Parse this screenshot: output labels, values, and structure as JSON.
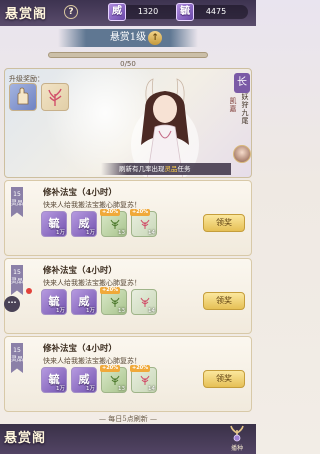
{
  "header": {
    "title": "悬赏阁",
    "help_label": "?",
    "resources": [
      {
        "icon": "currency-icon",
        "glyph": "威",
        "value": "1320"
      },
      {
        "icon": "currency-icon",
        "glyph": "毓",
        "value": "4475"
      }
    ]
  },
  "level": {
    "label": "悬赏1级",
    "upgrade_glyph": "↑",
    "progress_text": "0/50",
    "progress_fraction": 0
  },
  "hero": {
    "reward_label": "升级奖励：",
    "badge": "长",
    "name": "妖狩九尾",
    "title": "凯嘉",
    "refresh_prefix": "刷新有几率出现",
    "refresh_highlight": "灵品",
    "refresh_suffix": "任务"
  },
  "tasks": [
    {
      "level": "15",
      "tag": "灵品",
      "title": "修补法宝（4小时）",
      "desc": "快来人给我搬法宝搬心肺复苏！",
      "items": [
        {
          "glyph": "毓",
          "count": "1万",
          "kind": "purple"
        },
        {
          "glyph": "威",
          "count": "1万",
          "kind": "purple"
        },
        {
          "glyph": "",
          "count": "13",
          "bonus": "+20%",
          "kind": "green"
        },
        {
          "glyph": "",
          "count": "14",
          "bonus": "+20%",
          "kind": "pink"
        }
      ],
      "claim_label": "领奖"
    },
    {
      "level": "15",
      "tag": "灵品",
      "title": "修补法宝（4小时）",
      "desc": "快来人给我搬法宝搬心肺复苏！",
      "items": [
        {
          "glyph": "毓",
          "count": "1万",
          "kind": "purple"
        },
        {
          "glyph": "威",
          "count": "1万",
          "kind": "purple"
        },
        {
          "glyph": "",
          "count": "13",
          "bonus": "+20%",
          "kind": "green"
        },
        {
          "glyph": "",
          "count": "14",
          "bonus": "",
          "kind": "pink"
        }
      ],
      "claim_label": "领奖"
    },
    {
      "level": "15",
      "tag": "灵品",
      "title": "修补法宝（4小时）",
      "desc": "快来人给我搬法宝搬心肺复苏！",
      "items": [
        {
          "glyph": "毓",
          "count": "1万",
          "kind": "purple"
        },
        {
          "glyph": "威",
          "count": "1万",
          "kind": "purple"
        },
        {
          "glyph": "",
          "count": "13",
          "bonus": "+20%",
          "kind": "green"
        },
        {
          "glyph": "",
          "count": "14",
          "bonus": "+20%",
          "kind": "pink"
        }
      ],
      "claim_label": "领奖"
    }
  ],
  "side_chat_label": "···",
  "footer": {
    "refresh_note": "— 每日5点刷新 —",
    "back_label": "悬赏阁",
    "collect_label": "播种"
  },
  "colors": {
    "accent_purple": "#7454b0",
    "claim_gold": "#e6c056",
    "highlight": "#ffcf4a"
  }
}
